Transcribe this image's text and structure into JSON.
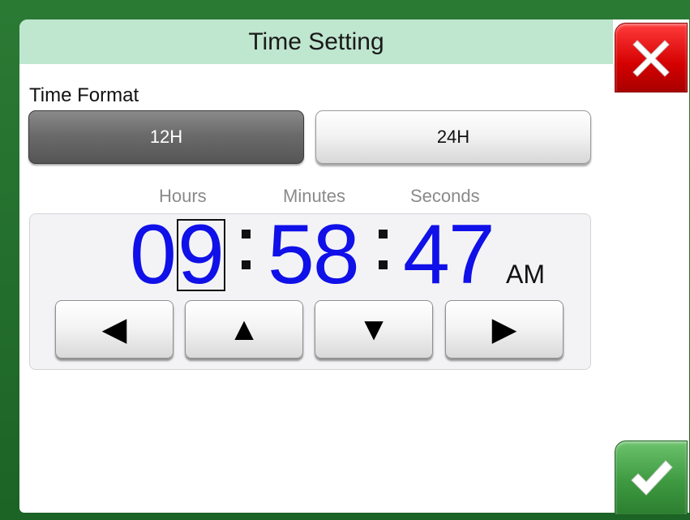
{
  "title": "Time Setting",
  "time_format": {
    "label": "Time Format",
    "options": [
      "12H",
      "24H"
    ],
    "selected": "12H"
  },
  "units": {
    "hours": "Hours",
    "minutes": "Minutes",
    "seconds": "Seconds"
  },
  "time": {
    "hours_tens": "0",
    "hours_ones": "9",
    "minutes": "58",
    "seconds": "47",
    "period": "AM"
  },
  "nav": {
    "left": "◀",
    "up": "▲",
    "down": "▼",
    "right": "▶"
  },
  "colors": {
    "title_bar": "#bfe6cf",
    "digit": "#1010e8",
    "close": "#d40000",
    "confirm": "#3e9a41",
    "frame": "#1f6a2c"
  },
  "icons": {
    "close": "close-icon",
    "confirm": "checkmark-icon"
  }
}
